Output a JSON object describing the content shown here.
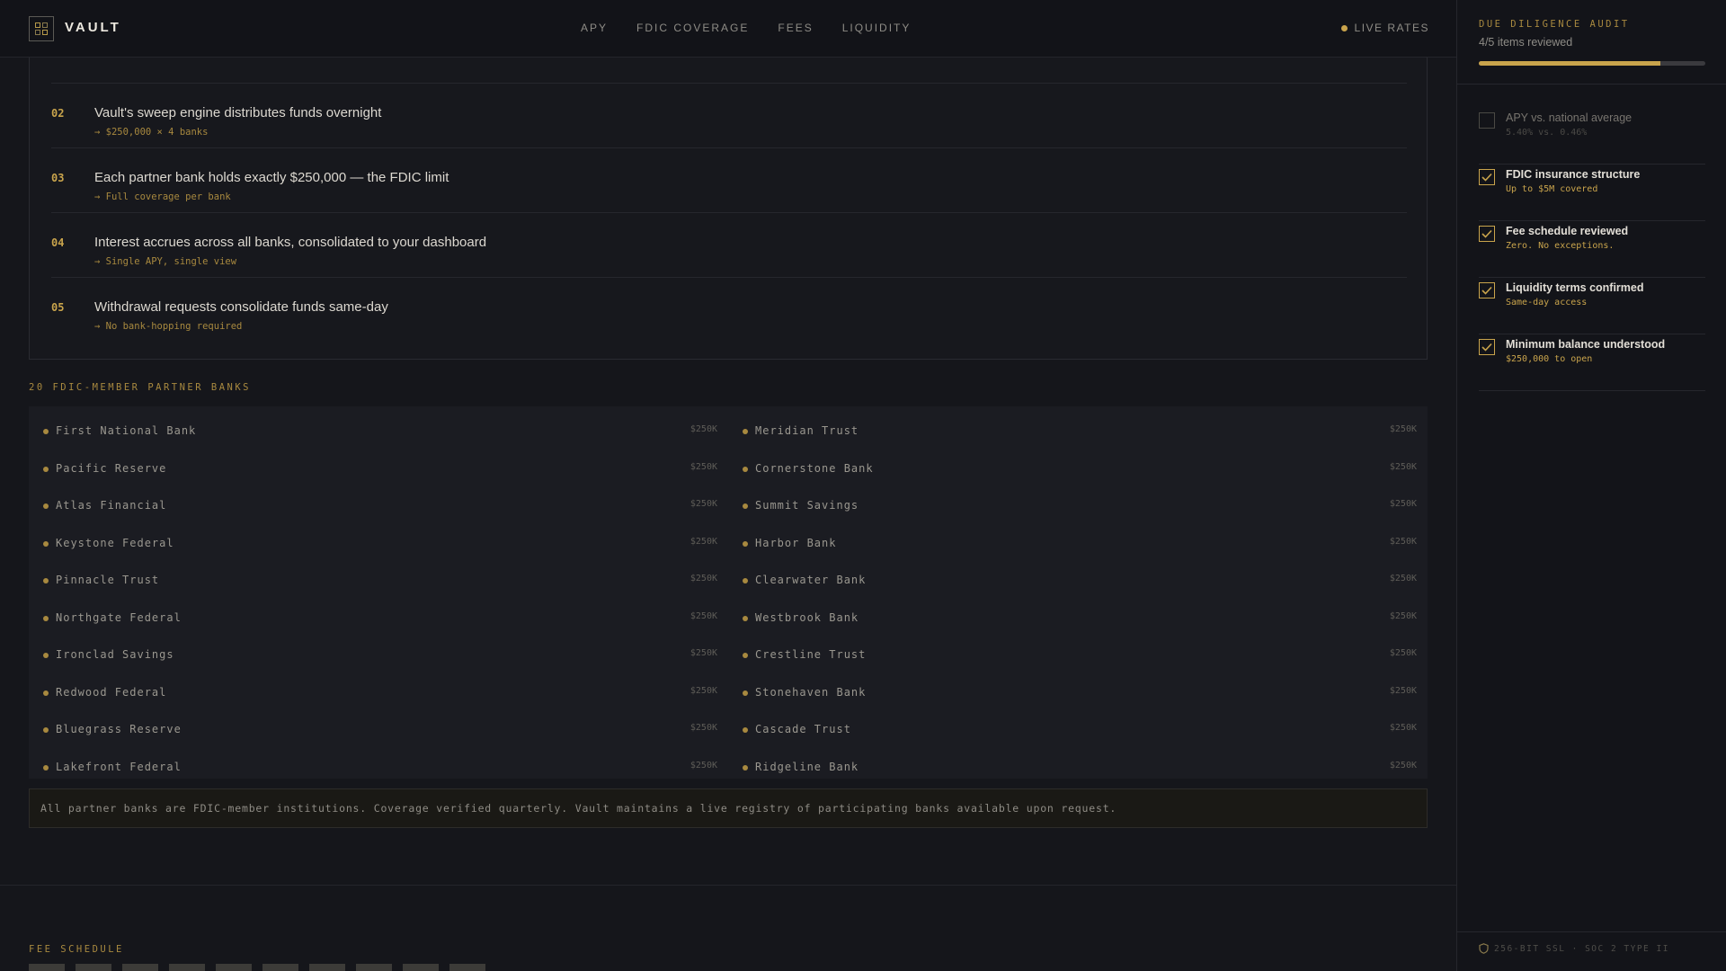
{
  "header": {
    "logo": "VAULT",
    "nav": [
      "APY",
      "FDIC COVERAGE",
      "FEES",
      "LIQUIDITY"
    ],
    "status": "LIVE RATES"
  },
  "steps": [
    {
      "num": "02",
      "title": "Vault's sweep engine distributes funds overnight",
      "sub": "→ $250,000 × 4 banks"
    },
    {
      "num": "03",
      "title": "Each partner bank holds exactly $250,000 — the FDIC limit",
      "sub": "→ Full coverage per bank"
    },
    {
      "num": "04",
      "title": "Interest accrues across all banks, consolidated to your dashboard",
      "sub": "→ Single APY, single view"
    },
    {
      "num": "05",
      "title": "Withdrawal requests consolidate funds same-day",
      "sub": "→ No bank-hopping required"
    }
  ],
  "partner_banks": {
    "label": "20 FDIC-MEMBER PARTNER BANKS",
    "left": [
      {
        "name": "First National Bank",
        "amount": "$250K"
      },
      {
        "name": "Pacific Reserve",
        "amount": "$250K"
      },
      {
        "name": "Atlas Financial",
        "amount": "$250K"
      },
      {
        "name": "Keystone Federal",
        "amount": "$250K"
      },
      {
        "name": "Pinnacle Trust",
        "amount": "$250K"
      },
      {
        "name": "Northgate Federal",
        "amount": "$250K"
      },
      {
        "name": "Ironclad Savings",
        "amount": "$250K"
      },
      {
        "name": "Redwood Federal",
        "amount": "$250K"
      },
      {
        "name": "Bluegrass Reserve",
        "amount": "$250K"
      },
      {
        "name": "Lakefront Federal",
        "amount": "$250K"
      }
    ],
    "right": [
      {
        "name": "Meridian Trust",
        "amount": "$250K"
      },
      {
        "name": "Cornerstone Bank",
        "amount": "$250K"
      },
      {
        "name": "Summit Savings",
        "amount": "$250K"
      },
      {
        "name": "Harbor Bank",
        "amount": "$250K"
      },
      {
        "name": "Clearwater Bank",
        "amount": "$250K"
      },
      {
        "name": "Westbrook Bank",
        "amount": "$250K"
      },
      {
        "name": "Crestline Trust",
        "amount": "$250K"
      },
      {
        "name": "Stonehaven Bank",
        "amount": "$250K"
      },
      {
        "name": "Cascade Trust",
        "amount": "$250K"
      },
      {
        "name": "Ridgeline Bank",
        "amount": "$250K"
      }
    ],
    "note": "All partner banks are FDIC-member institutions. Coverage verified quarterly. Vault maintains a live registry of participating banks available upon request."
  },
  "fee_schedule": {
    "label": "FEE SCHEDULE"
  },
  "audit": {
    "title": "DUE DILIGENCE AUDIT",
    "count": "4/5 items reviewed",
    "progress": 0.8,
    "items": [
      {
        "title": "APY vs. national average",
        "sub": "5.40% vs. 0.46%",
        "checked": false
      },
      {
        "title": "FDIC insurance structure",
        "sub": "Up to $5M covered",
        "checked": true
      },
      {
        "title": "Fee schedule reviewed",
        "sub": "Zero. No exceptions.",
        "checked": true
      },
      {
        "title": "Liquidity terms confirmed",
        "sub": "Same-day access",
        "checked": true
      },
      {
        "title": "Minimum balance understood",
        "sub": "$250,000 to open",
        "checked": true
      }
    ],
    "footer": "256-BIT SSL · SOC 2 TYPE II"
  },
  "colors": {
    "accent": "#c9a44c",
    "background": "#15161b"
  }
}
